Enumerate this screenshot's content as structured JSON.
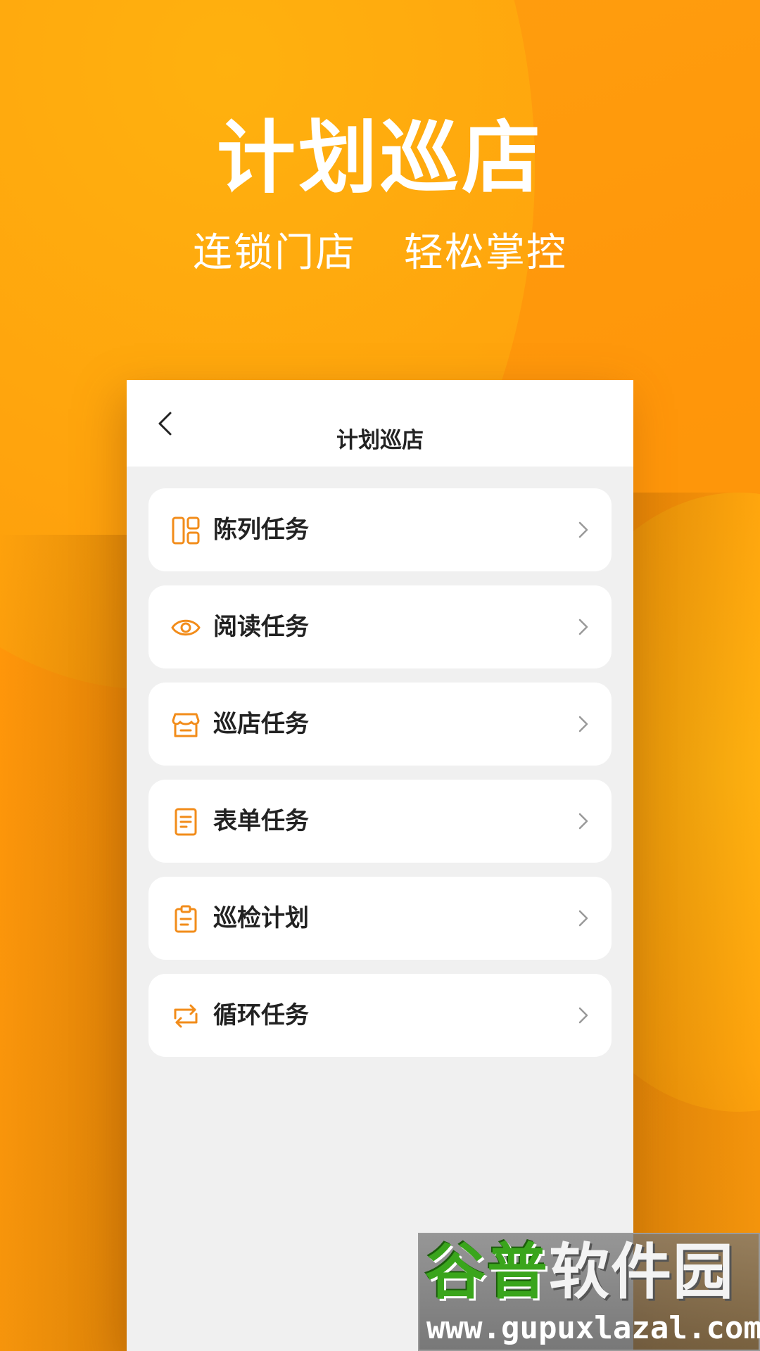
{
  "hero": {
    "title": "计划巡店",
    "subtitle_left": "连锁门店",
    "subtitle_right": "轻松掌控"
  },
  "nav": {
    "back_icon": "chevron-left-icon",
    "title": "计划巡店"
  },
  "menu": {
    "items": [
      {
        "label": "陈列任务",
        "icon": "layout-grid-icon"
      },
      {
        "label": "阅读任务",
        "icon": "eye-icon"
      },
      {
        "label": "巡店任务",
        "icon": "store-icon"
      },
      {
        "label": "表单任务",
        "icon": "document-icon"
      },
      {
        "label": "巡检计划",
        "icon": "clipboard-icon"
      },
      {
        "label": "循环任务",
        "icon": "repeat-icon"
      }
    ]
  },
  "watermark": {
    "text_green": "谷普",
    "text_white": "软件园",
    "url": "www.gupuxlazal.com"
  },
  "colors": {
    "accent": "#f28c1a",
    "background": "#ff9f0f",
    "card": "#ffffff",
    "list_bg": "#f0f0f0"
  }
}
